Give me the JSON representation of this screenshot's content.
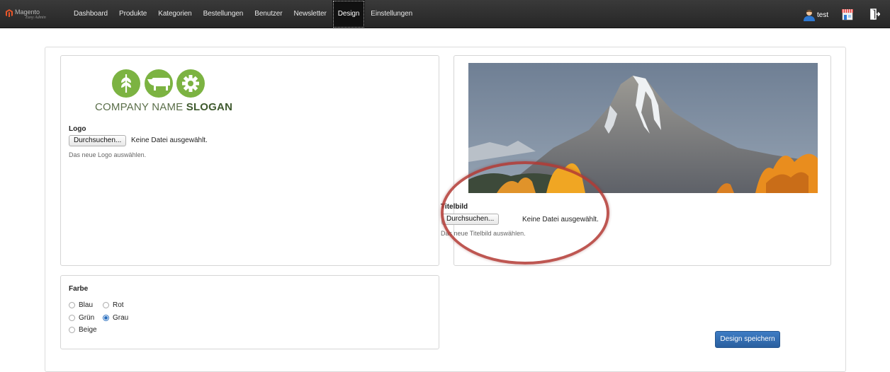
{
  "brand": {
    "name": "Magento",
    "subtitle": "Easy Admin",
    "accent": "#e8562a"
  },
  "nav": {
    "items": [
      {
        "label": "Dashboard"
      },
      {
        "label": "Produkte"
      },
      {
        "label": "Kategorien"
      },
      {
        "label": "Bestellungen"
      },
      {
        "label": "Benutzer"
      },
      {
        "label": "Newsletter"
      },
      {
        "label": "Design",
        "active": true
      },
      {
        "label": "Einstellungen"
      }
    ],
    "user": "test",
    "icons": [
      "user-icon",
      "store-icon",
      "logout-icon"
    ]
  },
  "logo_panel": {
    "logo_text_regular": "COMPANY NAME ",
    "logo_text_bold": "SLOGAN",
    "logo_color": "#7cb342",
    "label": "Logo",
    "button": "Durchsuchen...",
    "status": "Keine Datei ausgewählt.",
    "help": "Das neue Logo auswählen."
  },
  "title_panel": {
    "label": "Titelbild",
    "button": "Durchsuchen...",
    "status": "Keine Datei ausgewählt.",
    "help": "Das neue Titelbild auswählen.",
    "highlight_color": "#b33a34"
  },
  "color_panel": {
    "label": "Farbe",
    "options": [
      {
        "label": "Blau",
        "checked": false
      },
      {
        "label": "Rot",
        "checked": false
      },
      {
        "label": "Grün",
        "checked": false
      },
      {
        "label": "Grau",
        "checked": true
      },
      {
        "label": "Beige",
        "checked": false
      }
    ],
    "checked_color": "#2a6fbf"
  },
  "actions": {
    "save": "Design speichern",
    "save_color": "#2f6db3"
  }
}
